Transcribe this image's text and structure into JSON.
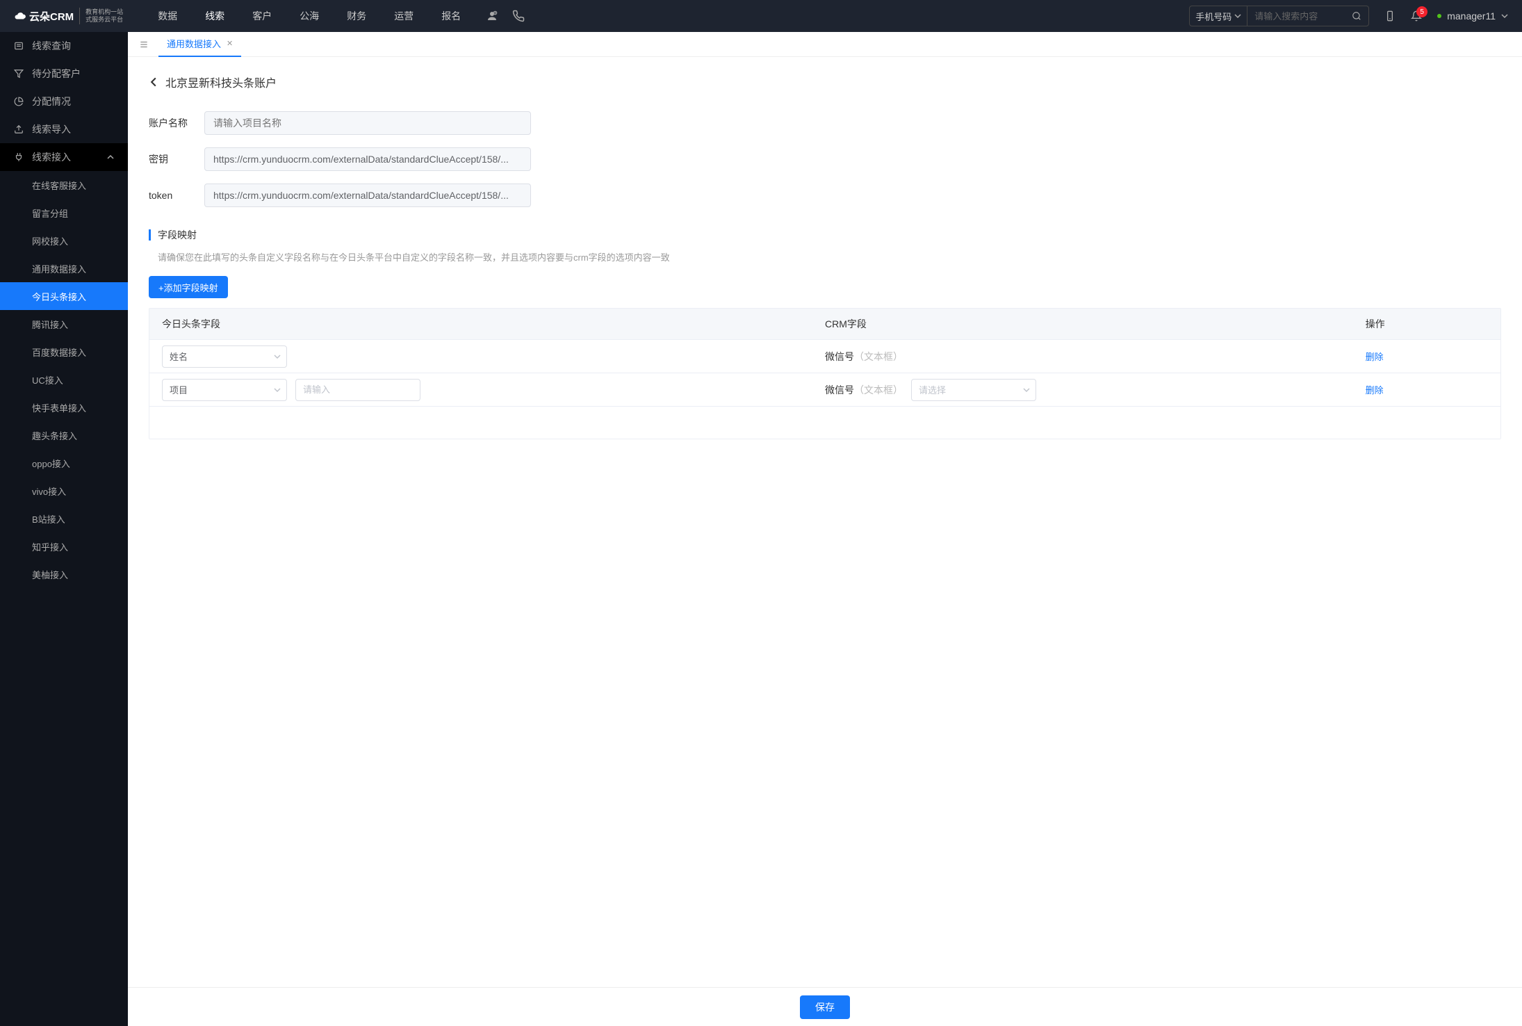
{
  "header": {
    "nav": [
      "数据",
      "线索",
      "客户",
      "公海",
      "财务",
      "运营",
      "报名"
    ],
    "active_nav": "线索",
    "search_select": "手机号码",
    "search_placeholder": "请输入搜索内容",
    "bell_count": "5",
    "user_name": "manager11"
  },
  "sidebar": {
    "items": [
      {
        "label": "线索查询"
      },
      {
        "label": "待分配客户"
      },
      {
        "label": "分配情况"
      },
      {
        "label": "线索导入"
      },
      {
        "label": "线索接入",
        "expanded": true
      }
    ],
    "sub_items": [
      "在线客服接入",
      "留言分组",
      "网校接入",
      "通用数据接入",
      "今日头条接入",
      "腾讯接入",
      "百度数据接入",
      "UC接入",
      "快手表单接入",
      "趣头条接入",
      "oppo接入",
      "vivo接入",
      "B站接入",
      "知乎接入",
      "美柚接入"
    ],
    "active_sub": "今日头条接入"
  },
  "tab": {
    "label": "通用数据接入"
  },
  "page": {
    "title": "北京昱新科技头条账户",
    "form": {
      "account_label": "账户名称",
      "account_placeholder": "请输入项目名称",
      "secret_label": "密钥",
      "secret_value": "https://crm.yunduocrm.com/externalData/standardClueAccept/158/...",
      "token_label": "token",
      "token_value": "https://crm.yunduocrm.com/externalData/standardClueAccept/158/..."
    },
    "section": {
      "title": "字段映射",
      "desc": "请确保您在此填写的头条自定义字段名称与在今日头条平台中自定义的字段名称一致，并且选项内容要与crm字段的选项内容一致",
      "add_btn": "+添加字段映射"
    },
    "table": {
      "headers": [
        "今日头条字段",
        "CRM字段",
        "操作"
      ],
      "rows": [
        {
          "toutiao": "姓名",
          "extra_input": null,
          "crm_main": "微信号",
          "crm_hint": "（文本框）",
          "crm_select": null,
          "action": "删除"
        },
        {
          "toutiao": "项目",
          "extra_input_placeholder": "请输入",
          "crm_main": "微信号",
          "crm_hint": "（文本框）",
          "crm_select_placeholder": "请选择",
          "action": "删除"
        }
      ]
    },
    "save": "保存"
  }
}
